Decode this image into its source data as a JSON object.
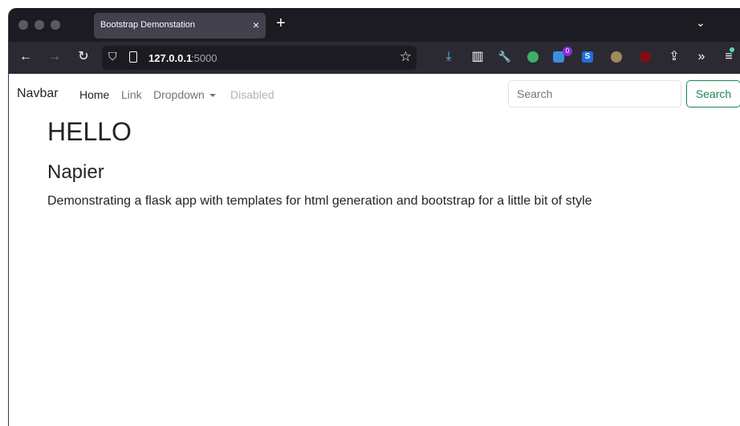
{
  "browser": {
    "tab": {
      "title": "Bootstrap Demonstation",
      "close": "×"
    },
    "new_tab": "+",
    "tab_list": "⌄",
    "url": {
      "host": "127.0.0.1",
      "port": ":5000"
    },
    "nav": {
      "back": "←",
      "forward": "→",
      "reload": "↻"
    },
    "icons": {
      "bookmark_star": "☆",
      "download": "⤓",
      "reader": "▥",
      "tools": "🔧",
      "extensions": "⇪",
      "overflow": "»",
      "menu": "≡"
    },
    "extension_badge_count": "0"
  },
  "navbar": {
    "brand": "Navbar",
    "links": [
      "Home",
      "Link",
      "Dropdown",
      "Disabled"
    ],
    "search_placeholder": "Search",
    "search_button": "Search"
  },
  "content": {
    "heading": "HELLO",
    "subheading": "Napier",
    "paragraph": "Demonstrating a flask app with templates for html generation and bootstrap for a little bit of style"
  },
  "colors": {
    "titlebar": "#1c1b22",
    "toolbar": "#2b2a33",
    "tab_active": "#42414d",
    "success": "#198754",
    "text": "#212529",
    "muted": "#6c757d"
  }
}
